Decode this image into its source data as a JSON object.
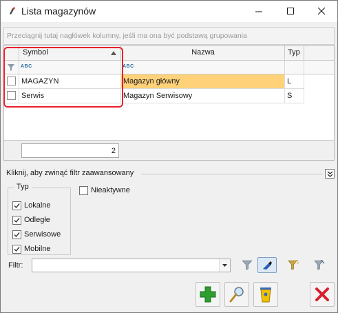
{
  "window": {
    "title": "Lista magazynów"
  },
  "grid": {
    "group_hint": "Przeciągnij tutaj nagłówek kolumny, jeśli ma ona być podstawą grupowania",
    "columns": [
      "Symbol",
      "Nazwa",
      "Typ"
    ],
    "filter_hint": "ABC",
    "rows": [
      {
        "symbol": "MAGAZYN",
        "nazwa": "Magazyn główny",
        "typ": "L",
        "selected": true
      },
      {
        "symbol": "Serwis",
        "nazwa": "Magazyn Serwisowy",
        "typ": "S",
        "selected": false
      }
    ],
    "count": "2"
  },
  "advanced": {
    "toggle_label": "Kliknij, aby zwinąć filtr zaawansowany",
    "typ_legend": "Typ",
    "typ_options": [
      {
        "label": "Lokalne",
        "checked": true
      },
      {
        "label": "Odległe",
        "checked": true
      },
      {
        "label": "Serwisowe",
        "checked": true
      },
      {
        "label": "Mobilne",
        "checked": true
      }
    ],
    "nieaktywne_label": "Nieaktywne",
    "nieaktywne_checked": false,
    "filter_label": "Filtr:",
    "filter_value": ""
  },
  "colors": {
    "selected_row": "#ffd27a",
    "highlight": "#e8202c",
    "add": "#2e9e2e",
    "delete": "#d8202a"
  },
  "icons": [
    "app-icon",
    "minimize-icon",
    "maximize-icon",
    "close-icon",
    "sort-up-icon",
    "filter-icon",
    "funnel-icon",
    "filter-clear-icon",
    "funnel-add-icon",
    "funnel-remove-icon",
    "add-icon",
    "edit-icon",
    "delete-bin-icon",
    "cancel-icon",
    "collapse-icon"
  ]
}
